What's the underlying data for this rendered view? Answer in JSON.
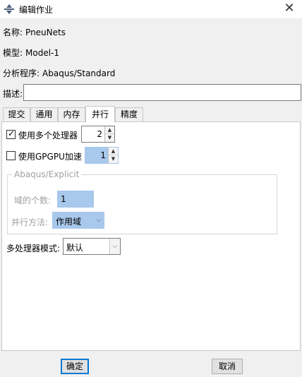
{
  "window": {
    "title": "编辑作业",
    "app_icon": "abaqus-icon",
    "close_icon": "close-icon"
  },
  "fields": {
    "name_label": "名称:",
    "name_value": "PneuNets",
    "model_label": "模型:",
    "model_value": "Model-1",
    "program_label": "分析程序:",
    "program_value": "Abaqus/Standard",
    "description_label": "描述:",
    "description_value": ""
  },
  "tabs": [
    "提交",
    "通用",
    "内存",
    "并行",
    "精度"
  ],
  "active_tab": "并行",
  "parallel": {
    "multi_cpu_label": "使用多个处理器",
    "multi_cpu_checked": true,
    "cpu_count": "2",
    "gpgpu_label": "使用GPGPU加速",
    "gpgpu_checked": false,
    "gpu_count": "1",
    "explicit_group": "Abaqus/Explicit",
    "domains_label": "域的个数:",
    "domains_value": "1",
    "method_label": "并行方法:",
    "method_value": "作用域",
    "mode_label": "多处理器模式:",
    "mode_value": "默认"
  },
  "buttons": {
    "ok": "确定",
    "cancel": "取消"
  },
  "colors": {
    "selection_blue": "#a8c8ec",
    "default_button_border": "#0078d7"
  }
}
